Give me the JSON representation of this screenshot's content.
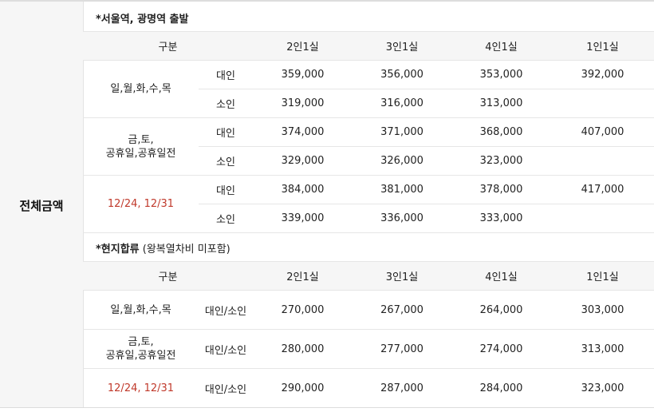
{
  "left_title": "전체금액",
  "sections": [
    {
      "title_bold": "*서울역, 광명역 출발",
      "title_rest": "",
      "headers": [
        "구분",
        "2인1실",
        "3인1실",
        "4인1실",
        "1인1실"
      ],
      "groups": [
        {
          "label": "일,월,화,수,목",
          "red": false,
          "rows": [
            {
              "type": "대인",
              "cells": [
                "359,000",
                "356,000",
                "353,000",
                "392,000"
              ]
            },
            {
              "type": "소인",
              "cells": [
                "319,000",
                "316,000",
                "313,000",
                ""
              ]
            }
          ]
        },
        {
          "label": "금,토,\n공휴일,공휴일전",
          "red": false,
          "rows": [
            {
              "type": "대인",
              "cells": [
                "374,000",
                "371,000",
                "368,000",
                "407,000"
              ]
            },
            {
              "type": "소인",
              "cells": [
                "329,000",
                "326,000",
                "323,000",
                ""
              ]
            }
          ]
        },
        {
          "label": "12/24,  12/31",
          "red": true,
          "rows": [
            {
              "type": "대인",
              "cells": [
                "384,000",
                "381,000",
                "378,000",
                "417,000"
              ]
            },
            {
              "type": "소인",
              "cells": [
                "339,000",
                "336,000",
                "333,000",
                ""
              ]
            }
          ]
        }
      ]
    },
    {
      "title_bold": "*현지합류",
      "title_rest": " (왕복열차비 미포함)",
      "headers": [
        "구분",
        "2인1실",
        "3인1실",
        "4인1실",
        "1인1실"
      ],
      "groups": [
        {
          "label": "일,월,화,수,목",
          "red": false,
          "rows": [
            {
              "type": "대인/소인",
              "cells": [
                "270,000",
                "267,000",
                "264,000",
                "303,000"
              ]
            }
          ]
        },
        {
          "label": "금,토,\n공휴일,공휴일전",
          "red": false,
          "rows": [
            {
              "type": "대인/소인",
              "cells": [
                "280,000",
                "277,000",
                "274,000",
                "313,000"
              ]
            }
          ]
        },
        {
          "label": "12/24,  12/31",
          "red": true,
          "rows": [
            {
              "type": "대인/소인",
              "cells": [
                "290,000",
                "287,000",
                "284,000",
                "323,000"
              ]
            }
          ]
        }
      ]
    }
  ]
}
